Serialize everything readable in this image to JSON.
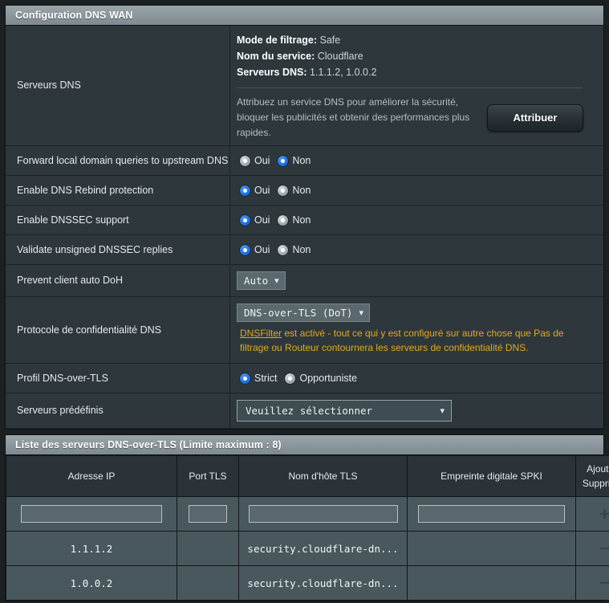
{
  "panel1": {
    "title": "Configuration DNS WAN",
    "rows": {
      "dns_servers": {
        "label": "Serveurs DNS",
        "info": [
          {
            "label": "Mode de filtrage:",
            "value": "Safe"
          },
          {
            "label": "Nom du service:",
            "value": "Cloudflare"
          },
          {
            "label": "Serveurs DNS:",
            "value": "1.1.1.2, 1.0.0.2"
          }
        ],
        "promo_text": "Attribuez un service DNS pour améliorer la sécurité, bloquer les publicités et obtenir des performances plus rapides.",
        "button_label": "Attribuer"
      },
      "forward_local": {
        "label": "Forward local domain queries to upstream DNS",
        "options": [
          {
            "label": "Oui",
            "selected": false
          },
          {
            "label": "Non",
            "selected": true
          }
        ]
      },
      "rebind": {
        "label": "Enable DNS Rebind protection",
        "options": [
          {
            "label": "Oui",
            "selected": true
          },
          {
            "label": "Non",
            "selected": false
          }
        ]
      },
      "dnssec": {
        "label": "Enable DNSSEC support",
        "options": [
          {
            "label": "Oui",
            "selected": true
          },
          {
            "label": "Non",
            "selected": false
          }
        ]
      },
      "validate_unsigned": {
        "label": "Validate unsigned DNSSEC replies",
        "options": [
          {
            "label": "Oui",
            "selected": true
          },
          {
            "label": "Non",
            "selected": false
          }
        ]
      },
      "prevent_doh": {
        "label": "Prevent client auto DoH",
        "select_value": "Auto"
      },
      "privacy_protocol": {
        "label": "Protocole de confidentialité DNS",
        "select_value": "DNS-over-TLS (DoT)",
        "warning_link": "DNSFilter",
        "warning_text": " est activé - tout ce qui y est configuré sur autre chose que Pas de filtrage ou Routeur contournera les serveurs de confidentialité DNS."
      },
      "dot_profile": {
        "label": "Profil DNS-over-TLS",
        "options": [
          {
            "label": "Strict",
            "selected": true
          },
          {
            "label": "Opportuniste",
            "selected": false
          }
        ]
      },
      "predefined": {
        "label": "Serveurs prédéfinis",
        "select_value": "Veuillez sélectionner"
      }
    }
  },
  "panel2": {
    "title": "Liste des serveurs DNS-over-TLS (Limite maximum : 8)",
    "columns": [
      "Adresse IP",
      "Port TLS",
      "Nom d'hôte TLS",
      "Empreinte digitale SPKI",
      "Ajouter / Supprimer"
    ],
    "input_row": {
      "ip": "",
      "port": "",
      "hostname": "",
      "spki": "",
      "action_icon": "plus-circle-icon"
    },
    "rows": [
      {
        "ip": "1.1.1.2",
        "port": "",
        "hostname": "security.cloudflare-dn...",
        "spki": "",
        "action_icon": "minus-circle-icon"
      },
      {
        "ip": "1.0.0.2",
        "port": "",
        "hostname": "security.cloudflare-dn...",
        "spki": "",
        "action_icon": "minus-circle-icon"
      }
    ]
  },
  "colors": {
    "panel_bg": "#2e383c",
    "page_bg": "#1b2023",
    "title_bar": "#8e999f",
    "accent_radio": "#1a73e8",
    "warning": "#e4a81c",
    "table_row": "#48585d"
  }
}
